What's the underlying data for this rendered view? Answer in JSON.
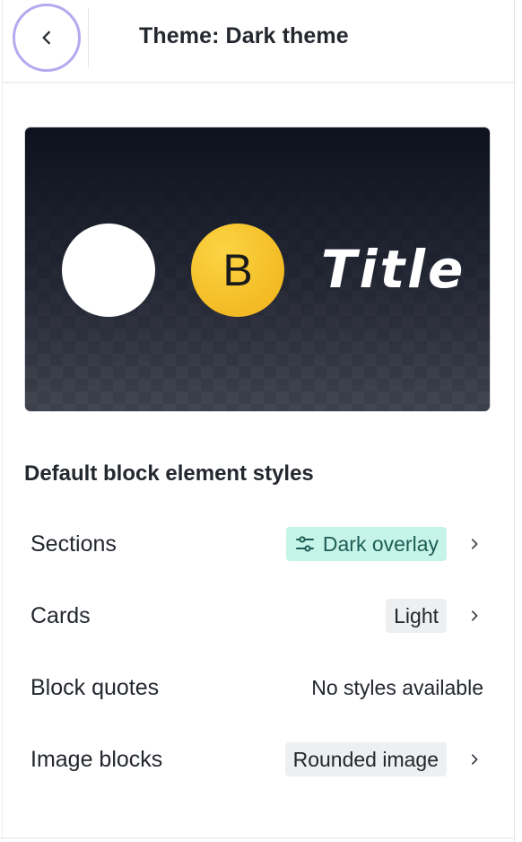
{
  "header": {
    "title": "Theme: Dark theme"
  },
  "icons": {
    "back": "chevron-left-icon",
    "row_chevron": "chevron-right-icon",
    "sections_badge": "sliders-icon"
  },
  "preview": {
    "accent_letter": "B",
    "title": "Title",
    "colors": {
      "background": "#141826",
      "swatch_primary": "#ffffff",
      "swatch_accent": "#f5c02a"
    }
  },
  "styles_section": {
    "heading": "Default block element styles",
    "rows": [
      {
        "label": "Sections",
        "value": "Dark overlay"
      },
      {
        "label": "Cards",
        "value": "Light"
      },
      {
        "label": "Block quotes",
        "value": "No styles available"
      },
      {
        "label": "Image blocks",
        "value": "Rounded image"
      }
    ]
  },
  "colors": {
    "focus_ring": "#b3aaf0",
    "teal_badge_bg": "#c6f4e8",
    "teal_badge_text": "#1d5d56",
    "neutral_badge_bg": "#eeeff1"
  }
}
